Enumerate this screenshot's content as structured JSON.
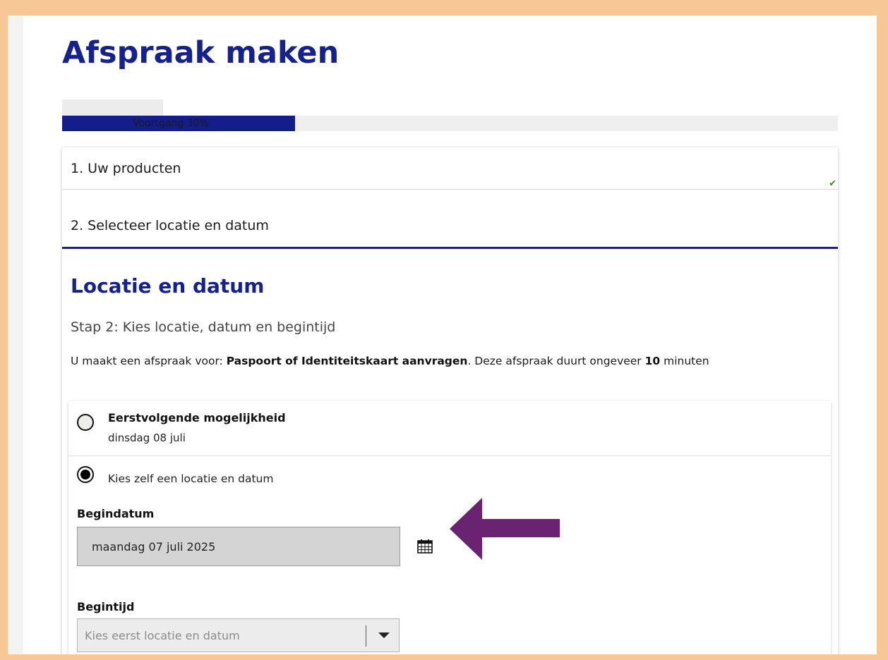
{
  "page": {
    "title": "Afspraak maken"
  },
  "progress": {
    "label": "Voortgang 30%",
    "percent": 30
  },
  "steps": [
    {
      "label": "1. Uw producten",
      "completed": true
    },
    {
      "label": "2. Selecteer locatie en datum",
      "active": true
    }
  ],
  "section": {
    "title": "Locatie en datum",
    "step_text": "Stap 2: Kies locatie, datum en begintijd",
    "info_prefix": "U maakt een afspraak voor: ",
    "info_product": "Paspoort of Identiteitskaart aanvragen",
    "info_mid": ". Deze afspraak duurt ongeveer ",
    "info_duration": "10",
    "info_suffix": " minuten"
  },
  "options": {
    "first": {
      "title": "Eerstvolgende mogelijkheid",
      "subtitle": "dinsdag 08 juli",
      "selected": false
    },
    "second": {
      "label": "Kies zelf een locatie en datum",
      "selected": true
    }
  },
  "date_field": {
    "label": "Begindatum",
    "value": "maandag 07 juli 2025",
    "icon": "calendar-icon"
  },
  "time_field": {
    "label": "Begintijd",
    "placeholder": "Kies eerst locatie en datum"
  },
  "colors": {
    "brand_blue": "#15218c",
    "progress_fill": "#131e8a",
    "check_green": "#3c8a25",
    "annotation_arrow": "#6a2370",
    "frame_border": "#f7c896"
  }
}
